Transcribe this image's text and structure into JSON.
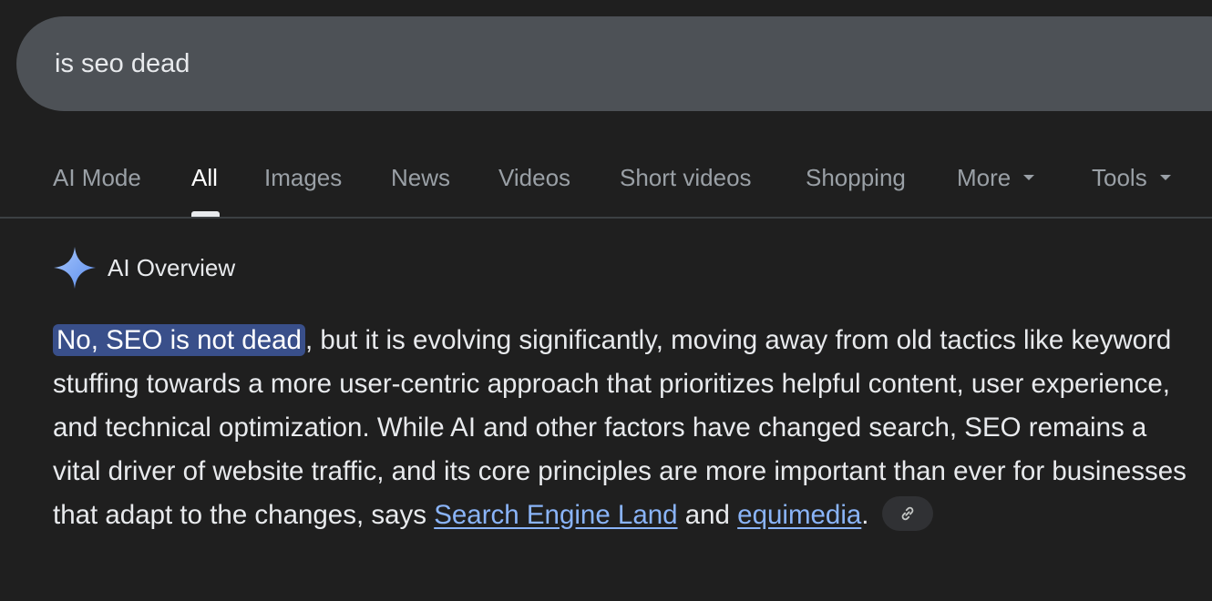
{
  "search": {
    "query": "is seo dead"
  },
  "tabs": [
    {
      "label": "AI Mode",
      "active": false
    },
    {
      "label": "All",
      "active": true
    },
    {
      "label": "Images",
      "active": false
    },
    {
      "label": "News",
      "active": false
    },
    {
      "label": "Videos",
      "active": false
    },
    {
      "label": "Short videos",
      "active": false
    },
    {
      "label": "Shopping",
      "active": false
    },
    {
      "label": "More",
      "active": false
    },
    {
      "label": "Tools",
      "active": false
    }
  ],
  "ai_overview": {
    "title": "AI Overview",
    "icon": "sparkle-icon",
    "highlight": "No, SEO is not dead",
    "body": ", but it is evolving significantly, moving away from old tactics like keyword stuffing towards a more user-centric approach that prioritizes helpful content, user experience, and technical optimization. While AI and other factors have changed search, SEO remains a vital driver of website traffic, and its core principles are more important than ever for businesses that adapt to the changes, says ",
    "source_1": "Search Engine Land",
    "conjunction": " and ",
    "source_2": "equimedia",
    "period": "."
  },
  "colors": {
    "background": "#1f1f1f",
    "search_bar": "#4d5156",
    "highlight": "#394f8a",
    "link": "#8ab4f8",
    "tab_inactive": "#9aa0a6",
    "sparkle": "#8ab4f8"
  }
}
